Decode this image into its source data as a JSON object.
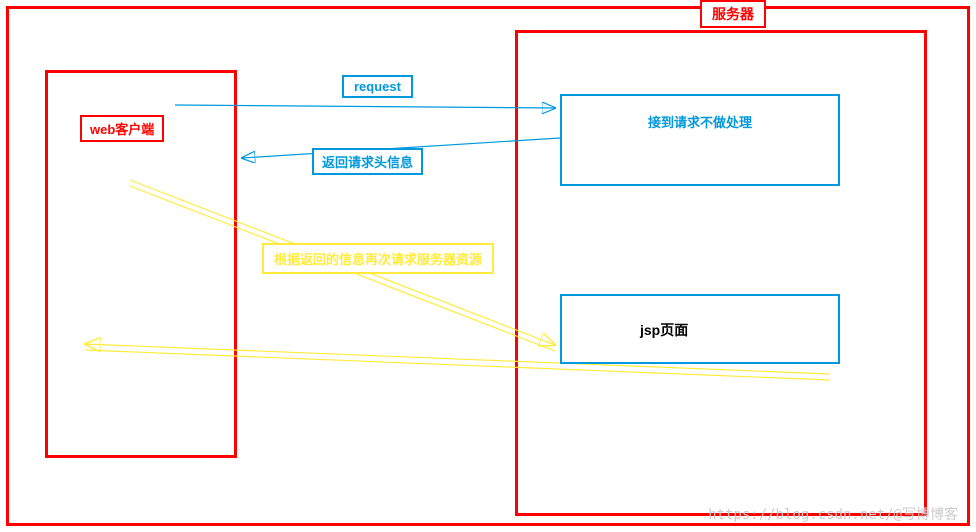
{
  "labels": {
    "server": "服务器",
    "client": "web客户端",
    "request": "request",
    "no_process": "接到请求不做处理",
    "return_header": "返回请求头信息",
    "retry_request": "根据返回的信息再次请求服务器资源",
    "jsp_page": "jsp页面"
  },
  "watermark": "https://blog.csdn.net/@写博博客",
  "arrows": {
    "request_out": {
      "from": "client",
      "to": "server_noprocess",
      "color": "#0099dd"
    },
    "return_header": {
      "from": "server_noprocess",
      "to": "client",
      "color": "#0099dd"
    },
    "retry": {
      "from": "client",
      "to": "jsp_box",
      "color": "#ffeb3b"
    },
    "jsp_return": {
      "from": "jsp_box",
      "to": "client",
      "color": "#ffeb3b"
    }
  }
}
